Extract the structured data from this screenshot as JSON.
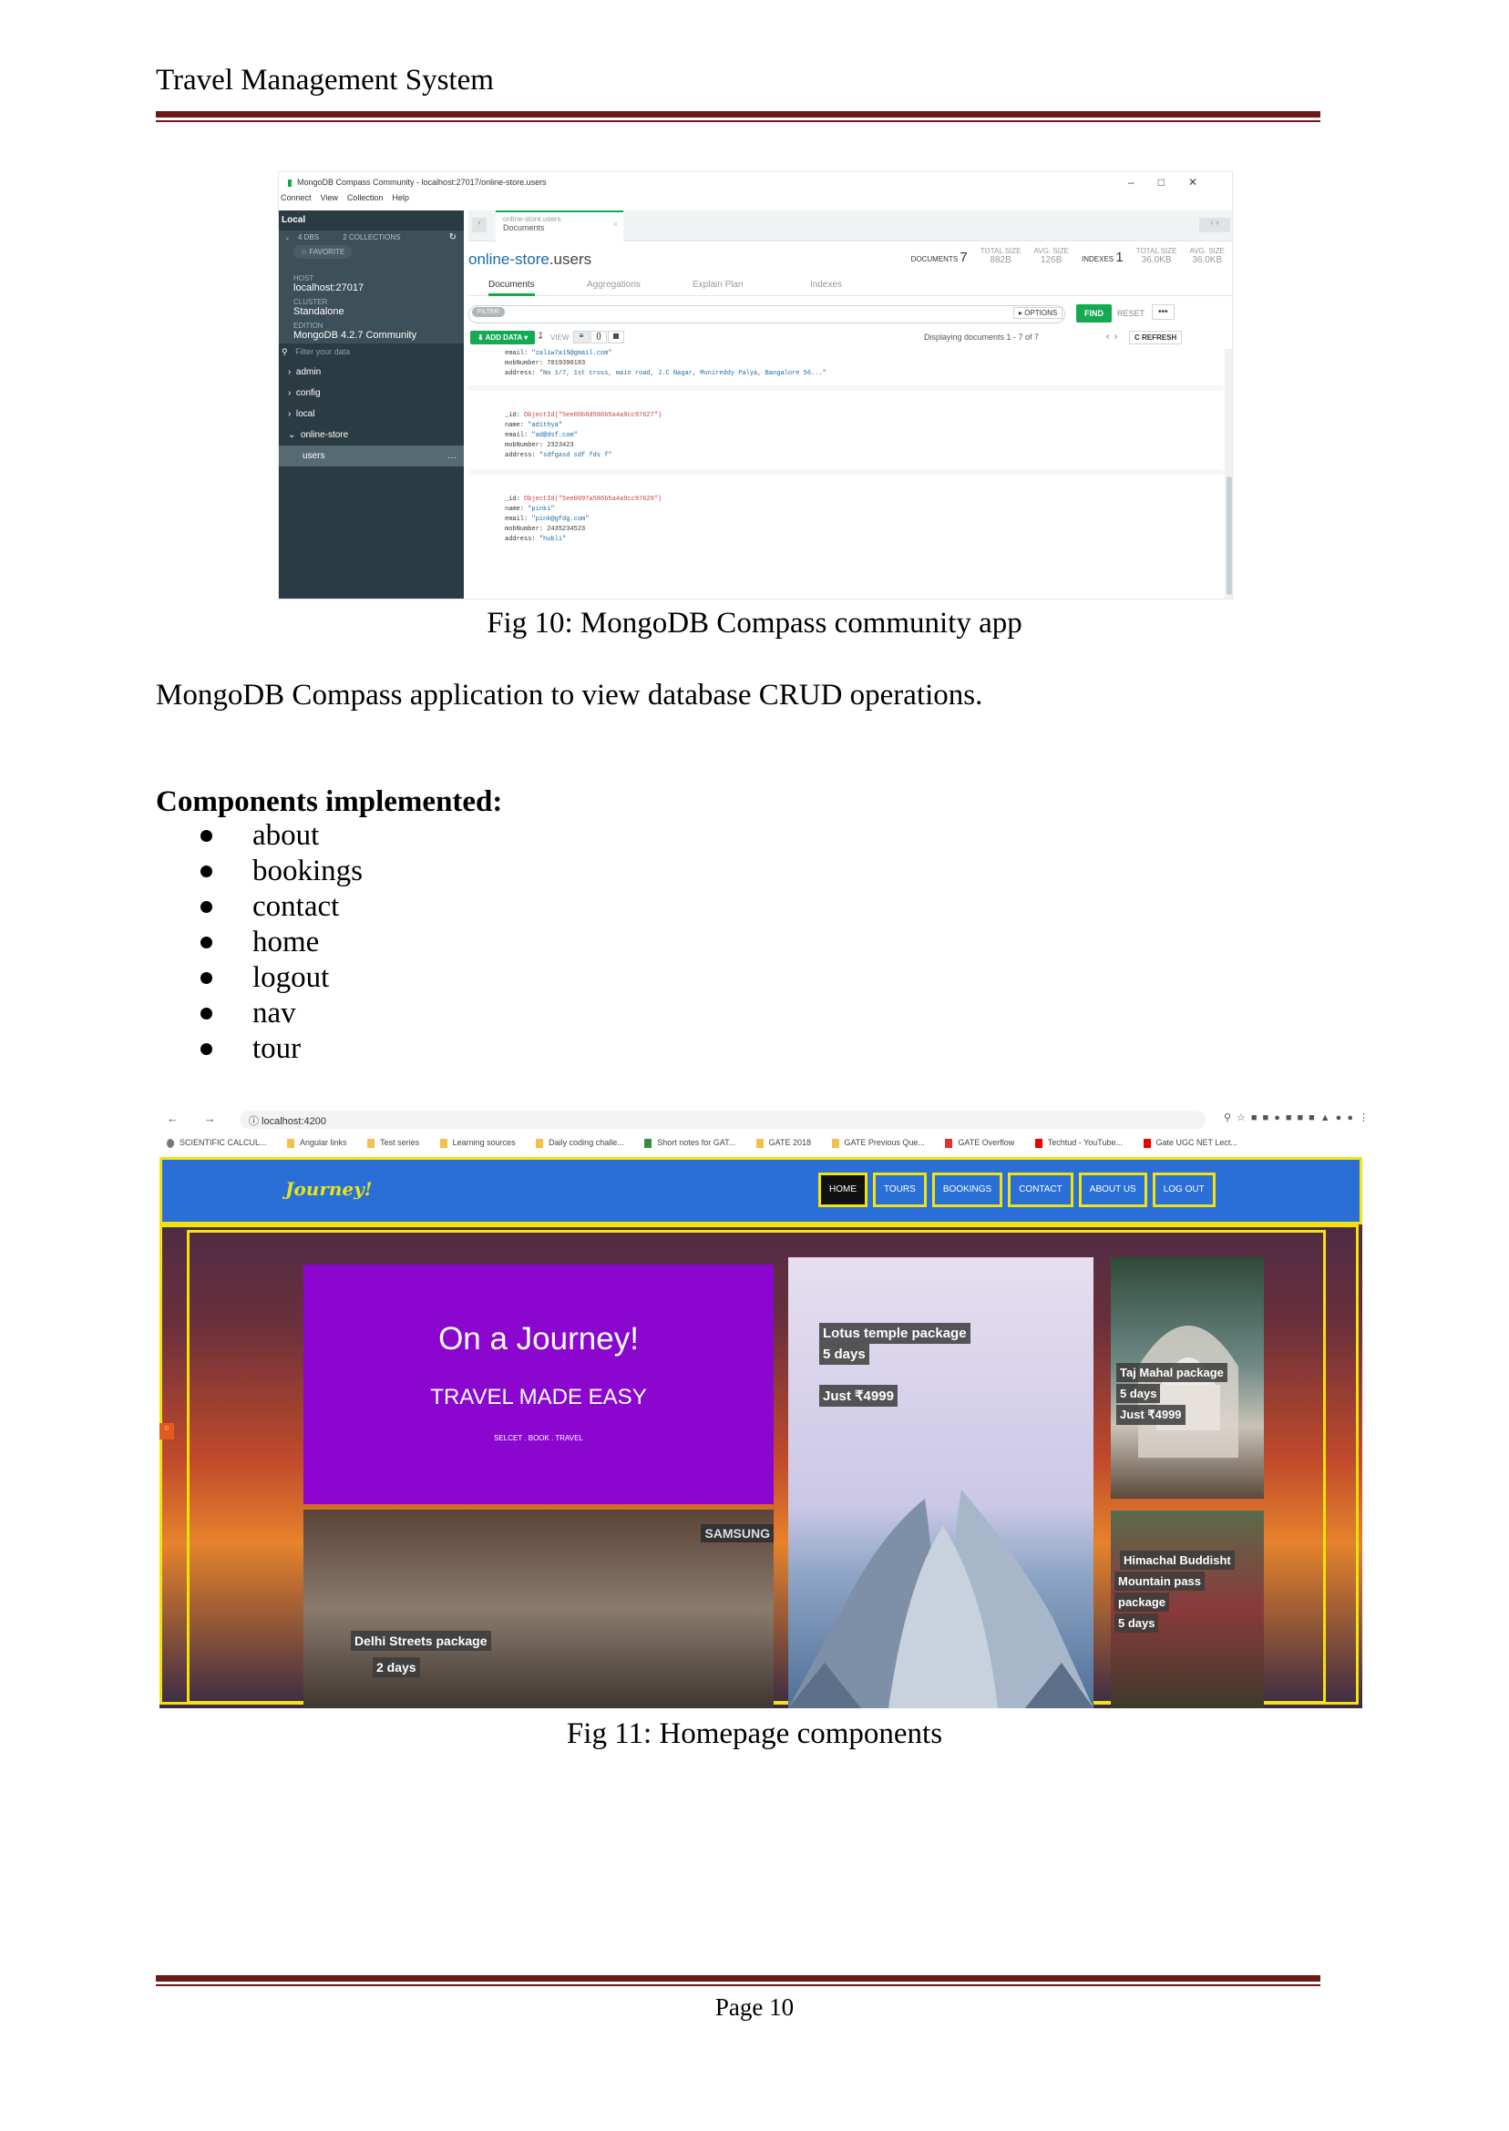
{
  "header": {
    "title": "Travel Management System"
  },
  "compass": {
    "window_title": "MongoDB Compass Community - localhost:27017/online-store.users",
    "window_buttons": [
      "–",
      "□",
      "✕"
    ],
    "menu": [
      "Connect",
      "View",
      "Collection",
      "Help"
    ],
    "sidebar": {
      "title": "Local",
      "dbs": "4 DBS",
      "collections": "2 COLLECTIONS",
      "favorite": "☆ FAVORITE",
      "host_label": "HOST",
      "host": "localhost:27017",
      "cluster_label": "CLUSTER",
      "cluster": "Standalone",
      "edition_label": "EDITION",
      "edition": "MongoDB 4.2.7 Community",
      "filter_placeholder": "Filter your data",
      "databases": [
        "admin",
        "config",
        "local",
        "online-store"
      ],
      "selected_collection": "users"
    },
    "tab": {
      "line1": "online-store.users",
      "line2": "Documents"
    },
    "namespace": {
      "db": "online-store",
      "coll": ".users"
    },
    "stats": {
      "documents_label": "DOCUMENTS",
      "documents": "7",
      "total_size_label": "TOTAL SIZE",
      "total_size": "882B",
      "avg_size_label": "AVG. SIZE",
      "avg_size": "126B",
      "indexes_label": "INDEXES",
      "indexes": "1",
      "idx_total_size": "36.0KB",
      "idx_avg_size": "36.0KB"
    },
    "subtabs": [
      "Documents",
      "Aggregations",
      "Explain Plan",
      "Indexes"
    ],
    "filter_pill": "FILTER",
    "options": "▸ OPTIONS",
    "find": "FIND",
    "reset": "RESET",
    "more": "•••",
    "add_data": "⬇ ADD DATA ▾",
    "view_label": "VIEW",
    "pagination": "Displaying documents 1 - 7 of 7",
    "refresh": "C REFRESH",
    "documents": [
      {
        "lines": [
          [
            "email: ",
            "\"zaliw7a15@gmail.com\""
          ],
          [
            "mobNumber: ",
            "7019390183"
          ],
          [
            "address: ",
            "\"No 1/7, 1st cross, main road, J.C Nagar, Munireddy Palya, Bangalore 56...\""
          ]
        ]
      },
      {
        "lines": [
          [
            "_id: ",
            "ObjectId(\"5ee00b8d586b5a4a9cc97627\")"
          ],
          [
            "name: ",
            "\"adithya\""
          ],
          [
            "email: ",
            "\"ad@dsf.com\""
          ],
          [
            "mobNumber: ",
            "2323423"
          ],
          [
            "address: ",
            "\"sdfgasd sdf  fds f\""
          ]
        ]
      },
      {
        "lines": [
          [
            "_id: ",
            "ObjectId(\"5ee0097a586b5a4a9cc97629\")"
          ],
          [
            "name: ",
            "\"pinki\""
          ],
          [
            "email: ",
            "\"pink@gfdg.com\""
          ],
          [
            "mobNumber: ",
            "2435234523"
          ],
          [
            "address: ",
            "\"hubli\""
          ]
        ]
      }
    ]
  },
  "fig10_caption": "Fig 10: MongoDB Compass community app",
  "paragraph": "MongoDB Compass application to view database CRUD operations.",
  "components_heading": "Components implemented:",
  "components": [
    "about",
    "bookings",
    "contact",
    "home",
    "logout",
    "nav",
    "tour"
  ],
  "browser": {
    "nav_icons": "← → C",
    "url": "ⓘ  localhost:4200",
    "bookmarks": [
      "SCIENTIFIC CALCUL...",
      "Angular links",
      "Test series",
      "Learning sources",
      "Daily coding challe...",
      "Short notes for GAT...",
      "GATE 2018",
      "GATE Previous Que...",
      "GATE Overflow",
      "Techtud - YouTube...",
      "Gate UGC NET Lect..."
    ]
  },
  "site": {
    "brand": "Journey!",
    "menu": [
      "HOME",
      "TOURS",
      "BOOKINGS",
      "CONTACT",
      "ABOUT US",
      "LOG OUT"
    ],
    "hero_title": "On a Journey!",
    "hero_subtitle": "TRAVEL MADE EASY",
    "hero_tagline": "SELCET . BOOK . TRAVEL",
    "cards": {
      "lotus": [
        "Lotus temple package",
        "5 days",
        "Just ₹4999"
      ],
      "taj": [
        "Taj Mahal package",
        "5 days",
        "Just ₹4999"
      ],
      "delhi": [
        "Delhi Streets package",
        "2 days"
      ],
      "himachal": [
        "Himachal Buddisht",
        "Mountain pass",
        "package",
        "5 days"
      ]
    }
  },
  "fig11_caption": "Fig 11: Homepage components",
  "footer": {
    "page": "Page 10"
  }
}
